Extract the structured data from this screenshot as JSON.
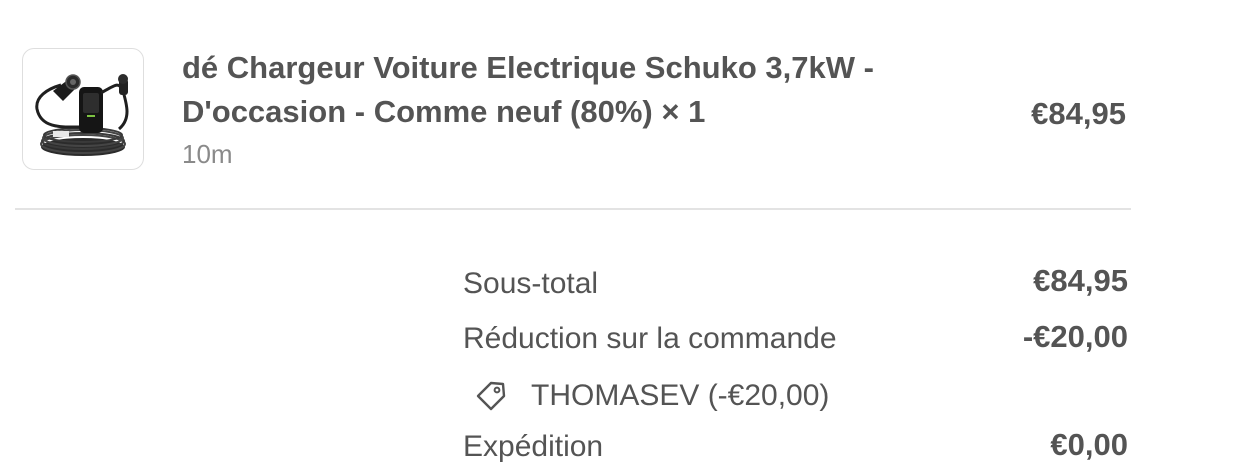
{
  "line_item": {
    "title": "dé Chargeur Voiture Electrique Schuko 3,7kW - D'occasion - Comme neuf (80%) × 1",
    "variant": "10m",
    "price": "€84,95",
    "thumbnail_icon": "ev-charger-cable-product-image"
  },
  "summary": {
    "subtotal_label": "Sous-total",
    "subtotal_value": "€84,95",
    "discount_label": "Réduction sur la commande",
    "discount_value": "-€20,00",
    "discount_code": "THOMASEV (-€20,00)",
    "discount_icon": "tag-icon",
    "shipping_label": "Expédition",
    "shipping_value": "€0,00"
  },
  "colors": {
    "text": "#545454",
    "muted": "#8a8a8a",
    "divider": "#e3e3e3",
    "border": "#dedede"
  }
}
